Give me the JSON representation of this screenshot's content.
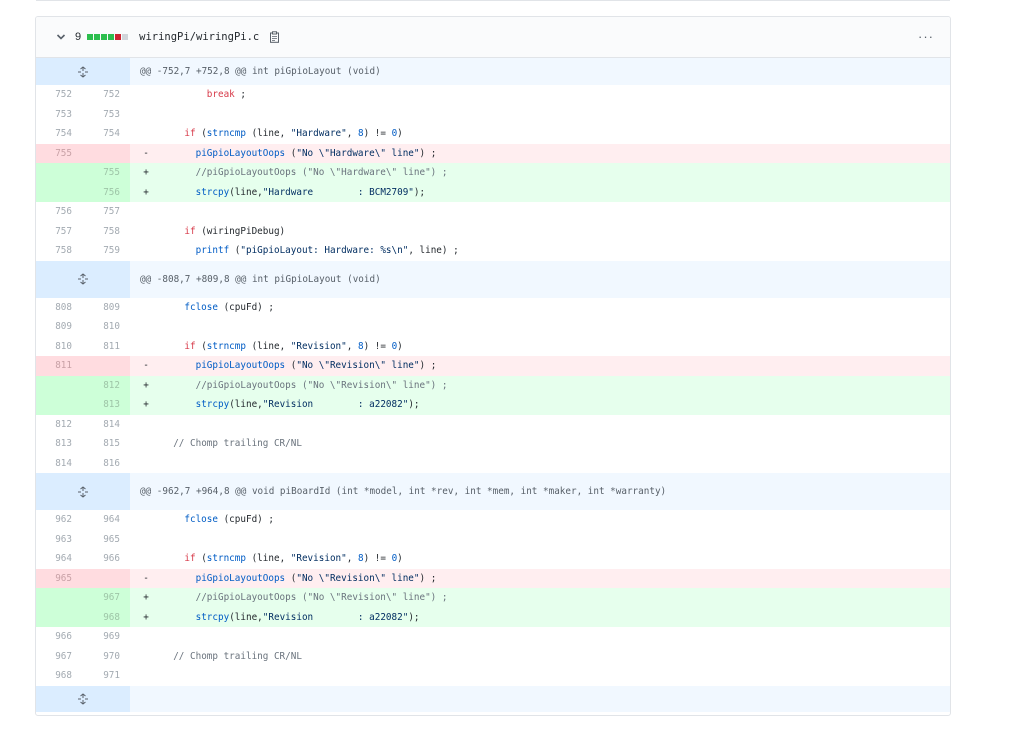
{
  "file": {
    "additions_count": "9",
    "path": "wiringPi/wiringPi.c",
    "menu": "···",
    "blocks": [
      "#2cbe4e",
      "#2cbe4e",
      "#2cbe4e",
      "#2cbe4e",
      "#cb2431",
      "#d1d5da"
    ]
  },
  "hunks": [
    {
      "header": "@@ -752,7 +752,8 @@ int piGpioLayout (void)",
      "lines": [
        {
          "type": "ctx",
          "old": "752",
          "new": "752",
          "code": "        break ;"
        },
        {
          "type": "ctx",
          "old": "753",
          "new": "753",
          "code": ""
        },
        {
          "type": "ctx",
          "old": "754",
          "new": "754",
          "code": "    if (strncmp (line, \"Hardware\", 8) != 0)"
        },
        {
          "type": "del",
          "old": "755",
          "new": "",
          "code": "      piGpioLayoutOops (\"No \\\"Hardware\\\" line\") ;"
        },
        {
          "type": "add",
          "old": "",
          "new": "755",
          "code": "      //piGpioLayoutOops (\"No \\\"Hardware\\\" line\") ;"
        },
        {
          "type": "add",
          "old": "",
          "new": "756",
          "code": "      strcpy(line,\"Hardware        : BCM2709\");"
        },
        {
          "type": "ctx",
          "old": "756",
          "new": "757",
          "code": ""
        },
        {
          "type": "ctx",
          "old": "757",
          "new": "758",
          "code": "    if (wiringPiDebug)"
        },
        {
          "type": "ctx",
          "old": "758",
          "new": "759",
          "code": "      printf (\"piGpioLayout: Hardware: %s\\n\", line) ;"
        }
      ]
    },
    {
      "header": "@@ -808,7 +809,8 @@ int piGpioLayout (void)",
      "lines": [
        {
          "type": "ctx",
          "old": "808",
          "new": "809",
          "code": "    fclose (cpuFd) ;"
        },
        {
          "type": "ctx",
          "old": "809",
          "new": "810",
          "code": ""
        },
        {
          "type": "ctx",
          "old": "810",
          "new": "811",
          "code": "    if (strncmp (line, \"Revision\", 8) != 0)"
        },
        {
          "type": "del",
          "old": "811",
          "new": "",
          "code": "      piGpioLayoutOops (\"No \\\"Revision\\\" line\") ;"
        },
        {
          "type": "add",
          "old": "",
          "new": "812",
          "code": "      //piGpioLayoutOops (\"No \\\"Revision\\\" line\") ;"
        },
        {
          "type": "add",
          "old": "",
          "new": "813",
          "code": "      strcpy(line,\"Revision        : a22082\");"
        },
        {
          "type": "ctx",
          "old": "812",
          "new": "814",
          "code": ""
        },
        {
          "type": "ctx",
          "old": "813",
          "new": "815",
          "code": "  // Chomp trailing CR/NL"
        },
        {
          "type": "ctx",
          "old": "814",
          "new": "816",
          "code": ""
        }
      ]
    },
    {
      "header": "@@ -962,7 +964,8 @@ void piBoardId (int *model, int *rev, int *mem, int *maker, int *warranty)",
      "lines": [
        {
          "type": "ctx",
          "old": "962",
          "new": "964",
          "code": "    fclose (cpuFd) ;"
        },
        {
          "type": "ctx",
          "old": "963",
          "new": "965",
          "code": ""
        },
        {
          "type": "ctx",
          "old": "964",
          "new": "966",
          "code": "    if (strncmp (line, \"Revision\", 8) != 0)"
        },
        {
          "type": "del",
          "old": "965",
          "new": "",
          "code": "      piGpioLayoutOops (\"No \\\"Revision\\\" line\") ;"
        },
        {
          "type": "add",
          "old": "",
          "new": "967",
          "code": "      //piGpioLayoutOops (\"No \\\"Revision\\\" line\") ;"
        },
        {
          "type": "add",
          "old": "",
          "new": "968",
          "code": "      strcpy(line,\"Revision        : a22082\");"
        },
        {
          "type": "ctx",
          "old": "966",
          "new": "969",
          "code": ""
        },
        {
          "type": "ctx",
          "old": "967",
          "new": "970",
          "code": "  // Chomp trailing CR/NL"
        },
        {
          "type": "ctx",
          "old": "968",
          "new": "971",
          "code": ""
        }
      ]
    }
  ],
  "footer_header": ""
}
